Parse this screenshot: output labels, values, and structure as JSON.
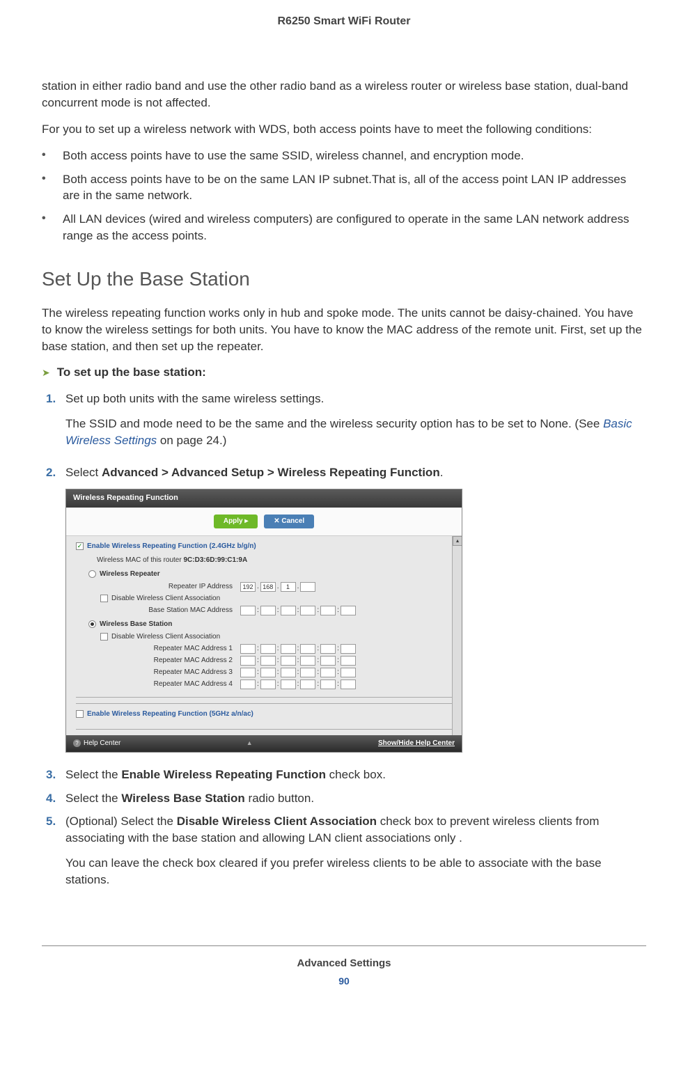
{
  "header": {
    "product_title": "R6250 Smart WiFi Router"
  },
  "intro": {
    "para1": "station in either radio band and use the other radio band as a wireless router or wireless base station, dual-band concurrent mode is not affected.",
    "para2": "For you to set up a wireless network with WDS, both access points have to meet the following conditions:"
  },
  "conditions": {
    "item1": "Both access points have to use the same SSID, wireless channel, and encryption mode.",
    "item2": "Both access points have to be on the same LAN IP subnet.That is, all of the access point LAN IP addresses are in the same network.",
    "item3": "All LAN devices (wired and wireless computers) are configured to operate in the same LAN network address range as the access points."
  },
  "section": {
    "heading": "Set Up the Base Station",
    "para": "The wireless repeating function works only in hub and spoke mode. The units cannot be daisy-chained. You have to know the wireless settings for both units. You have to know the MAC address of the remote unit. First, set up the base station, and then set up the repeater."
  },
  "procedure": {
    "title": "To set up the base station:",
    "steps": {
      "s1": {
        "main": "Set up both units with the same wireless settings.",
        "sub_a": "The SSID and mode need to be the same and the wireless security option has to be set to None. (See ",
        "sub_link": "Basic Wireless Settings",
        "sub_b": " on page 24.)"
      },
      "s2": {
        "pre": "Select ",
        "bold": "Advanced > Advanced Setup > Wireless Repeating Function",
        "post": "."
      },
      "s3": {
        "pre": "Select the ",
        "bold": "Enable Wireless Repeating Function",
        "post": " check box."
      },
      "s4": {
        "pre": "Select the ",
        "bold": "Wireless Base Station",
        "post": " radio button."
      },
      "s5": {
        "pre": "(Optional) Select the ",
        "bold": "Disable Wireless Client Association",
        "post": " check box to prevent wireless clients from associating with the base station and allowing LAN client associations only .",
        "sub": "You can leave the check box cleared if you prefer wireless clients to be able to associate with the base stations."
      }
    }
  },
  "screenshot": {
    "title": "Wireless Repeating Function",
    "apply": "Apply ▸",
    "cancel": "✕ Cancel",
    "enable24": "Enable Wireless Repeating Function (2.4GHz b/g/n)",
    "mac_label": "Wireless MAC of this router ",
    "mac_value": "9C:D3:6D:99:C1:9A",
    "wireless_repeater": "Wireless Repeater",
    "repeater_ip": "Repeater IP Address",
    "ip1": "192",
    "ip2": "168",
    "ip3": "1",
    "disable_assoc": "Disable Wireless Client Association",
    "base_mac": "Base Station MAC Address",
    "wireless_base": "Wireless Base Station",
    "rep_mac1": "Repeater MAC Address 1",
    "rep_mac2": "Repeater MAC Address 2",
    "rep_mac3": "Repeater MAC Address 3",
    "rep_mac4": "Repeater MAC Address 4",
    "enable5": "Enable Wireless Repeating Function (5GHz a/n/ac)",
    "help_center": "Help Center",
    "show_hide": "Show/Hide Help Center"
  },
  "footer": {
    "section": "Advanced Settings",
    "page": "90"
  }
}
